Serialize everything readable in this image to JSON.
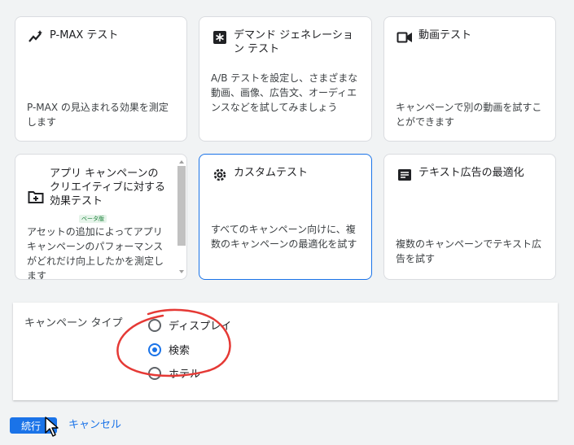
{
  "cards": [
    {
      "id": "pmax",
      "icon": "trend-sparkle-icon",
      "title": "P-MAX テスト",
      "description": "P-MAX の見込まれる効果を測定します"
    },
    {
      "id": "demand-gen",
      "icon": "asterisk-box-icon",
      "title": "デマンド ジェネレーション テスト",
      "description": "A/B テストを設定し、さまざまな動画、画像、広告文、オーディエンスなどを試してみましょう"
    },
    {
      "id": "video",
      "icon": "videocam-icon",
      "title": "動画テスト",
      "description": "キャンペーンで別の動画を試すことができます"
    },
    {
      "id": "app",
      "icon": "folder-add-icon",
      "title": "アプリ キャンペーンのクリエイティブに対する効果テスト",
      "badge": "ベータ版",
      "description": "アセットの追加によってアプリ キャンペーンのパフォーマンスがどれだけ向上したかを測定します"
    },
    {
      "id": "custom",
      "icon": "gear-icon",
      "title": "カスタムテスト",
      "description": "すべてのキャンペーン向けに、複数のキャンペーンの最適化を試す",
      "selected": true
    },
    {
      "id": "text-ad",
      "icon": "text-box-icon",
      "title": "テキスト広告の最適化",
      "description": "複数のキャンペーンでテキスト広告を試す"
    }
  ],
  "campaign_type": {
    "label": "キャンペーン タイプ",
    "options": [
      {
        "label": "ディスプレイ",
        "checked": false
      },
      {
        "label": "検索",
        "checked": true
      },
      {
        "label": "ホテル",
        "checked": false
      }
    ]
  },
  "actions": {
    "continue": "続行",
    "cancel": "キャンセル"
  },
  "colors": {
    "accent": "#1a73e8",
    "annotation": "#e53935"
  }
}
